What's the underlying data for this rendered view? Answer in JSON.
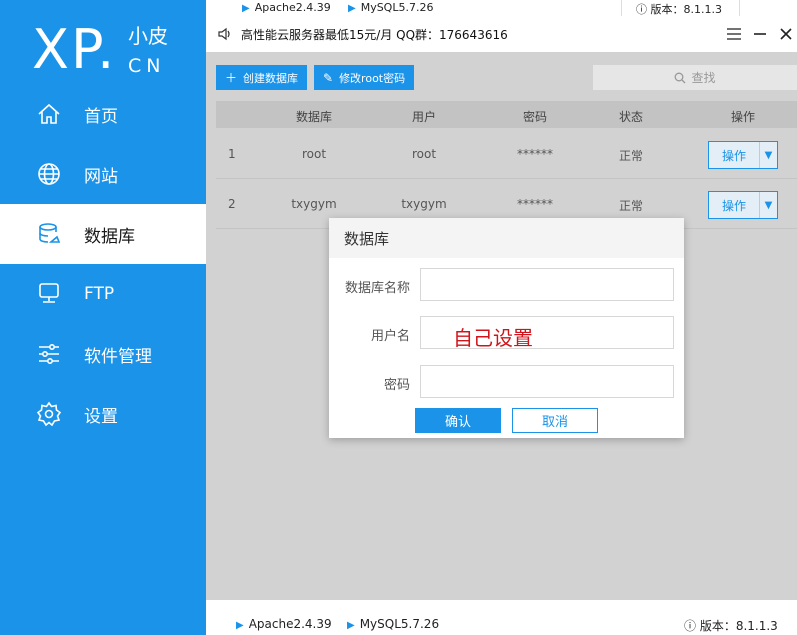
{
  "logo": {
    "main": "XP.",
    "cn": "小皮",
    "en": "CN"
  },
  "sidebar": {
    "items": [
      {
        "label": "首页",
        "icon": "home-icon"
      },
      {
        "label": "网站",
        "icon": "globe-icon"
      },
      {
        "label": "数据库",
        "icon": "database-icon",
        "active": true
      },
      {
        "label": "FTP",
        "icon": "ftp-icon"
      },
      {
        "label": "软件管理",
        "icon": "sliders-icon"
      },
      {
        "label": "设置",
        "icon": "gear-icon"
      }
    ]
  },
  "top_strip": {
    "apache": "Apache2.4.39",
    "mysql": "MySQL5.7.26",
    "version": "版本：8.1.1.3"
  },
  "titlebar": {
    "notice": "高性能云服务器最低15元/月 QQ群：176643616"
  },
  "toolbar": {
    "create_label": "创建数据库",
    "modify_label": "修改root密码",
    "search_placeholder": "查找"
  },
  "table": {
    "headers": [
      "数据库",
      "用户",
      "密码",
      "状态",
      "操作"
    ],
    "rows": [
      {
        "index": "1",
        "db": "root",
        "user": "root",
        "password": "******",
        "status": "正常",
        "action": "操作"
      },
      {
        "index": "2",
        "db": "txygym",
        "user": "txygym",
        "password": "******",
        "status": "正常",
        "action": "操作"
      }
    ]
  },
  "dialog": {
    "title": "数据库",
    "db_name_label": "数据库名称",
    "username_label": "用户名",
    "password_label": "密码",
    "db_name_value": "",
    "username_value": "",
    "password_value": "",
    "annotation": "自己设置",
    "ok_label": "确认",
    "cancel_label": "取消"
  },
  "statusbar": {
    "apache": "Apache2.4.39",
    "mysql": "MySQL5.7.26",
    "version": "版本：8.1.1.3"
  },
  "colors": {
    "accent": "#1a93e8",
    "annotation": "#d0141b",
    "overlay": "#d2d2d2"
  }
}
